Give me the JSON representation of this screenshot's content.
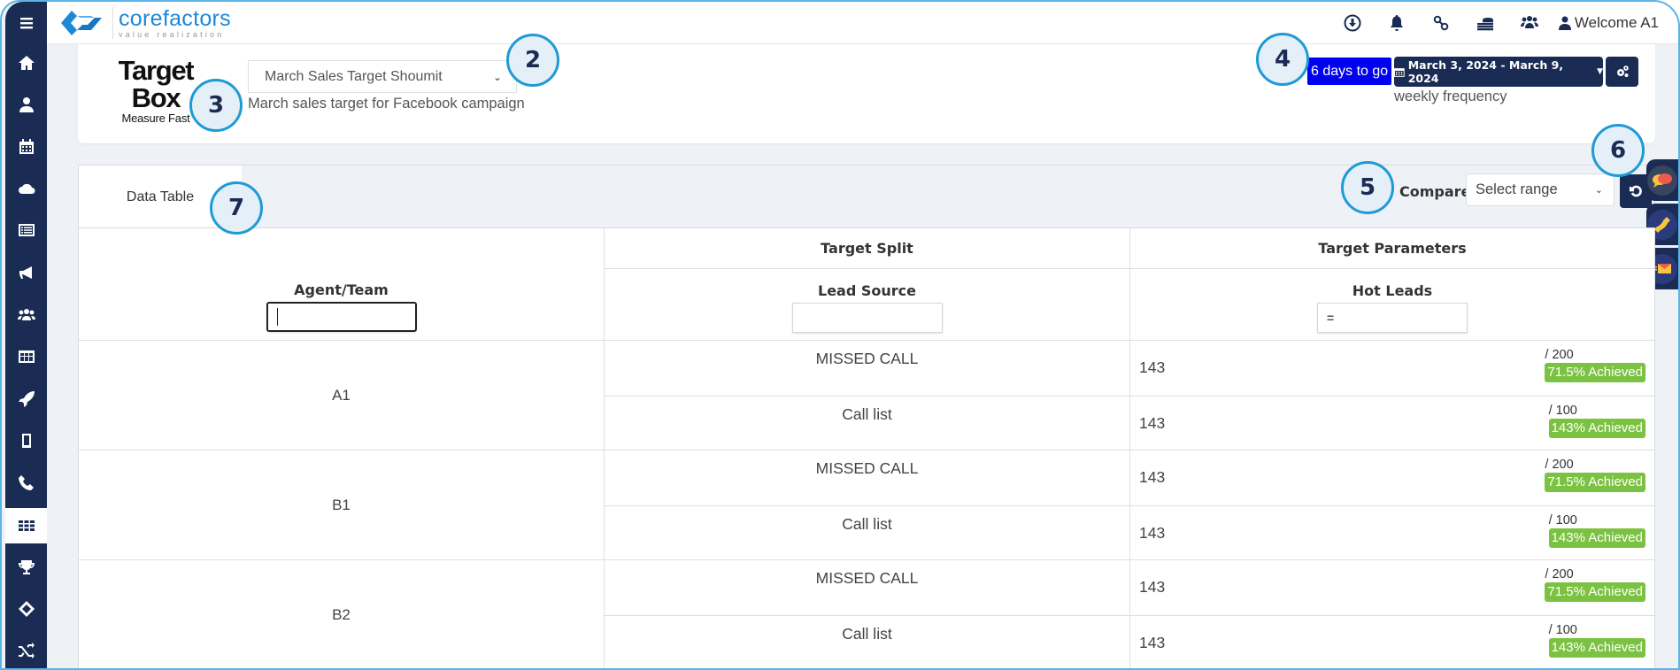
{
  "app": {
    "brand_name": "corefactors",
    "brand_tagline": "value realization"
  },
  "sidebar": {
    "items": [
      {
        "name": "menu",
        "icon": "hamburger-icon",
        "active": false
      },
      {
        "name": "home",
        "icon": "home-icon",
        "active": false
      },
      {
        "name": "contacts",
        "icon": "user-icon",
        "active": false
      },
      {
        "name": "calendar",
        "icon": "calendar-icon",
        "active": false
      },
      {
        "name": "cloud",
        "icon": "cloud-icon",
        "active": false
      },
      {
        "name": "lists",
        "icon": "list-icon",
        "active": false
      },
      {
        "name": "campaigns",
        "icon": "megaphone-icon",
        "active": false
      },
      {
        "name": "teams",
        "icon": "users-icon",
        "active": false
      },
      {
        "name": "table",
        "icon": "table-icon",
        "active": false
      },
      {
        "name": "launch",
        "icon": "rocket-icon",
        "active": false
      },
      {
        "name": "mobile",
        "icon": "tablet-icon",
        "active": false
      },
      {
        "name": "calls",
        "icon": "phone-icon",
        "active": false
      },
      {
        "name": "target-box",
        "icon": "grid-icon",
        "active": true
      },
      {
        "name": "achievements",
        "icon": "trophy-icon",
        "active": false
      },
      {
        "name": "tickets",
        "icon": "ticket-icon",
        "active": false
      },
      {
        "name": "workflows",
        "icon": "shuffle-icon",
        "active": false
      }
    ]
  },
  "topbar": {
    "icons": [
      "download-icon",
      "bell-icon",
      "link-icon",
      "coins-icon",
      "team-icon"
    ],
    "welcome": "Welcome A1"
  },
  "header": {
    "module_title": "Target Box",
    "module_subtitle": "Measure Fast",
    "target_select_value": "March Sales Target Shoumit",
    "target_description": "March sales target for Facebook campaign",
    "days_badge": "6 days to go",
    "date_range": "March 3, 2024 - March 9, 2024",
    "frequency": "weekly frequency",
    "colors": {
      "days_badge": "#0000f0",
      "primary": "#1a2c54",
      "achieved": "#7cc242"
    }
  },
  "tabs": {
    "active": "Data Table",
    "compare_label": "Compare",
    "compare_placeholder": "Select range"
  },
  "table": {
    "group_headers": {
      "split": "Target Split",
      "params": "Target Parameters"
    },
    "columns": {
      "agent": "Agent/Team",
      "source": "Lead Source",
      "metric": "Hot Leads"
    },
    "filters": {
      "agent": "",
      "source": "",
      "metric": "="
    },
    "groups": [
      {
        "agent": "A1",
        "rows": [
          {
            "source": "MISSED CALL",
            "value": "143",
            "target": "/ 200",
            "achieved": "71.5% Achieved"
          },
          {
            "source": "Call list",
            "value": "143",
            "target": "/ 100",
            "achieved": "143% Achieved"
          }
        ]
      },
      {
        "agent": "B1",
        "rows": [
          {
            "source": "MISSED CALL",
            "value": "143",
            "target": "/ 200",
            "achieved": "71.5% Achieved"
          },
          {
            "source": "Call list",
            "value": "143",
            "target": "/ 100",
            "achieved": "143% Achieved"
          }
        ]
      },
      {
        "agent": "B2",
        "rows": [
          {
            "source": "MISSED CALL",
            "value": "143",
            "target": "/ 200",
            "achieved": "71.5% Achieved"
          },
          {
            "source": "Call list",
            "value": "143",
            "target": "/ 100",
            "achieved": "143% Achieved"
          }
        ]
      }
    ]
  },
  "annotations": [
    "2",
    "3",
    "4",
    "5",
    "6",
    "7"
  ]
}
